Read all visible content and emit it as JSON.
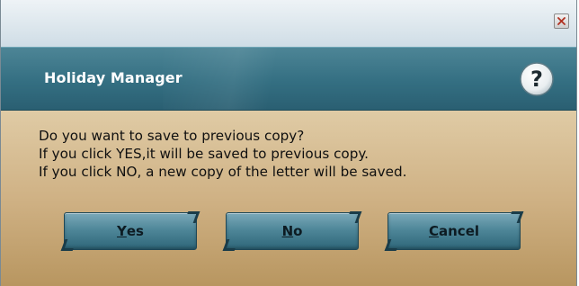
{
  "window": {
    "close_icon": "close-icon"
  },
  "header": {
    "title": "Holiday Manager",
    "help_icon": "question-mark-icon"
  },
  "message": {
    "line1": "Do you want to save to previous copy?",
    "line2": "If you click YES,it will be saved to previous copy.",
    "line3": "If you click NO, a new copy of the letter will be saved."
  },
  "buttons": {
    "yes": {
      "accel": "Y",
      "rest": "es"
    },
    "no": {
      "accel": "N",
      "rest": "o"
    },
    "cancel": {
      "accel": "C",
      "rest": "ancel"
    }
  },
  "colors": {
    "header_bg": "#346f82",
    "body_bg_top": "#f3ebd9",
    "body_bg_bottom": "#b89660",
    "button_bg": "#4f8799",
    "close_x": "#b03020"
  }
}
